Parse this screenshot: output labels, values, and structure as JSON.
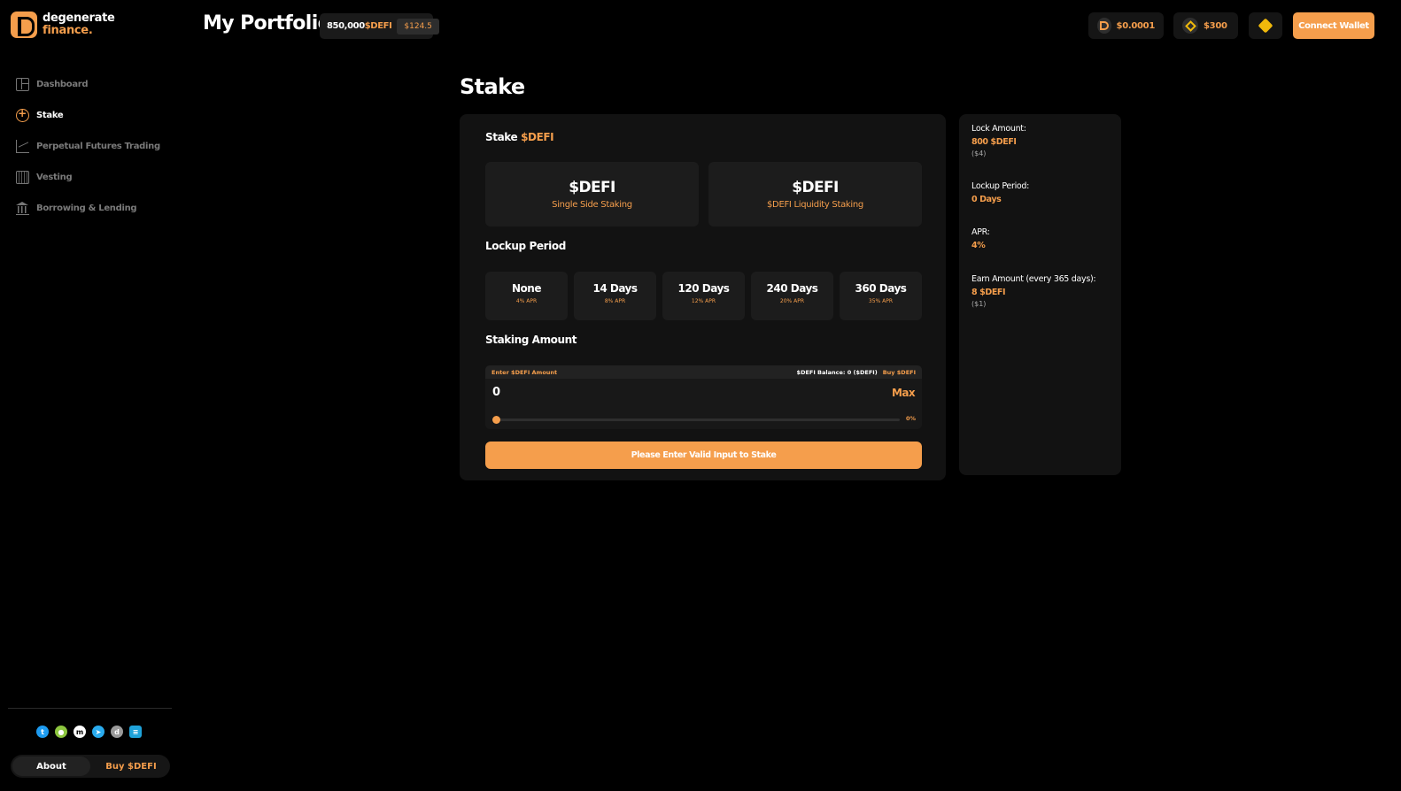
{
  "brand": {
    "line1": "degenerate",
    "line2": "finance.",
    "accent": "#f59e4c"
  },
  "sidebar": {
    "items": [
      {
        "label": "Dashboard",
        "icon": "dashboard-icon",
        "active": false
      },
      {
        "label": "Stake",
        "icon": "stake-icon",
        "active": true
      },
      {
        "label": "Perpetual Futures Trading",
        "icon": "chart-icon",
        "active": false
      },
      {
        "label": "Vesting",
        "icon": "vesting-icon",
        "active": false
      },
      {
        "label": "Borrowing & Lending",
        "icon": "bank-icon",
        "active": false
      }
    ],
    "socials": [
      {
        "icon": "twitter-icon",
        "color": "#1d9bf0"
      },
      {
        "icon": "coingecko-icon",
        "color": "#8dc63f"
      },
      {
        "icon": "coinmarketcap-icon",
        "color": "#ffffff"
      },
      {
        "icon": "telegram-icon",
        "color": "#2aabee"
      },
      {
        "icon": "dextools-icon",
        "color": "#9a9a9a"
      },
      {
        "icon": "docs-icon",
        "color": "#1fa2d9"
      }
    ],
    "about_label": "About",
    "buy_label": "Buy $DEFI"
  },
  "header": {
    "title": "My Portfolio",
    "balance_amount": "850,000",
    "balance_token": "$DEFI",
    "balance_usd": "$124.5",
    "defi_price": "$0.0001",
    "bnb_price": "$300",
    "connect_label": "Connect Wallet"
  },
  "stake": {
    "title": "Stake",
    "heading_prefix": "Stake ",
    "heading_token": "$DEFI",
    "types": [
      {
        "title": "$DEFI",
        "subtitle": "Single Side Staking"
      },
      {
        "title": "$DEFI",
        "subtitle": "$DEFI Liquidity Staking"
      }
    ],
    "lockup_heading": "Lockup Period",
    "lockups": [
      {
        "days": "None",
        "apr": "4% APR"
      },
      {
        "days": "14 Days",
        "apr": "8% APR"
      },
      {
        "days": "120 Days",
        "apr": "12% APR"
      },
      {
        "days": "240 Days",
        "apr": "20% APR"
      },
      {
        "days": "360 Days",
        "apr": "35% APR"
      }
    ],
    "amount_heading": "Staking Amount",
    "amount_label": "Enter $DEFI Amount",
    "balance_label": "$DEFI Balance: 0 ($DEFI)",
    "buy_label": "Buy $DEFI",
    "amount_value": "0",
    "max_label": "Max",
    "slider_pct": "0%",
    "slider_fraction": 0,
    "submit_label": "Please Enter Valid Input to Stake"
  },
  "summary": {
    "lock_label": "Lock Amount:",
    "lock_value": "800 $DEFI",
    "lock_usd": "($4)",
    "period_label": "Lockup Period:",
    "period_value": "0 Days",
    "apr_label": "APR:",
    "apr_value": "4%",
    "earn_label": "Earn Amount (every 365 days):",
    "earn_value": "8 $DEFI",
    "earn_usd": "($1)"
  }
}
